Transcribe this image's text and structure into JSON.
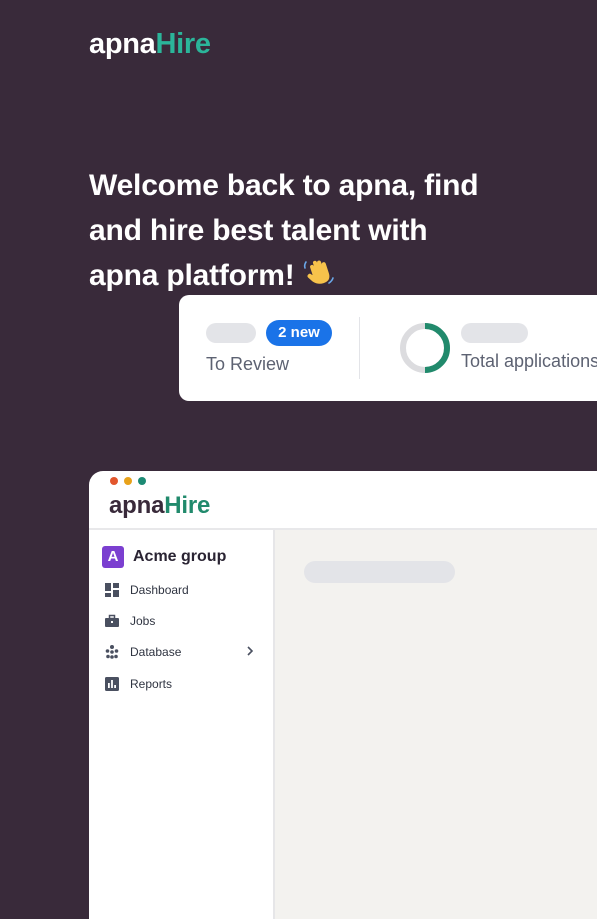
{
  "brand": {
    "logo_part1": "apna",
    "logo_part2": "Hire",
    "accent_color": "#2bb59a",
    "background_color": "#392a3a"
  },
  "hero": {
    "line1": "Welcome back to apna, find",
    "line2": "and hire best talent with",
    "line3": "apna platform!",
    "emoji": "👋"
  },
  "stats": {
    "review_badge": "2 new",
    "review_label": "To Review",
    "applications_label": "Total applications"
  },
  "app": {
    "logo_part1": "apna",
    "logo_part2": "Hire",
    "org_initial": "A",
    "org_name": "Acme group",
    "nav": [
      {
        "label": "Dashboard",
        "icon": "dashboard-icon"
      },
      {
        "label": "Jobs",
        "icon": "briefcase-icon"
      },
      {
        "label": "Database",
        "icon": "people-icon"
      },
      {
        "label": "Reports",
        "icon": "bar-chart-icon"
      }
    ]
  }
}
